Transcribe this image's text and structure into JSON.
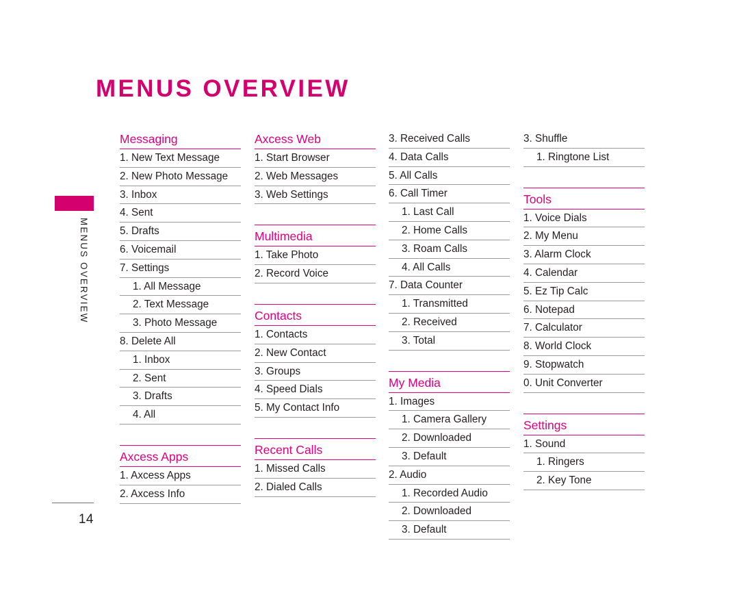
{
  "page": {
    "title": "MENUS OVERVIEW",
    "running_head": "MENUS OVERVIEW",
    "folio": "14",
    "accent_color": "#e0007d",
    "title_color": "#d4006e",
    "rule_color": "#9b9b9b",
    "text_color": "#231f20"
  },
  "columns": [
    {
      "name": "column-1",
      "sections": [
        {
          "heading": "Messaging",
          "has_top_rule": false,
          "items": [
            {
              "label": "1. New Text Message",
              "level": 1
            },
            {
              "label": "2. New Photo Message",
              "level": 1
            },
            {
              "label": "3. Inbox",
              "level": 1
            },
            {
              "label": "4. Sent",
              "level": 1
            },
            {
              "label": "5. Drafts",
              "level": 1
            },
            {
              "label": "6. Voicemail",
              "level": 1
            },
            {
              "label": "7. Settings",
              "level": 1
            },
            {
              "label": "1. All Message",
              "level": 2
            },
            {
              "label": "2. Text Message",
              "level": 2
            },
            {
              "label": "3. Photo Message",
              "level": 2
            },
            {
              "label": "8. Delete All",
              "level": 1
            },
            {
              "label": "1. Inbox",
              "level": 2
            },
            {
              "label": "2. Sent",
              "level": 2
            },
            {
              "label": "3. Drafts",
              "level": 2
            },
            {
              "label": "4. All",
              "level": 2
            }
          ]
        },
        {
          "heading": "Axcess Apps",
          "has_top_rule": true,
          "items": [
            {
              "label": "1. Axcess Apps",
              "level": 1
            },
            {
              "label": "2. Axcess Info",
              "level": 1
            }
          ]
        }
      ]
    },
    {
      "name": "column-2",
      "sections": [
        {
          "heading": "Axcess Web",
          "has_top_rule": false,
          "items": [
            {
              "label": "1. Start Browser",
              "level": 1
            },
            {
              "label": "2. Web Messages",
              "level": 1
            },
            {
              "label": "3. Web Settings",
              "level": 1
            }
          ]
        },
        {
          "heading": "Multimedia",
          "has_top_rule": true,
          "items": [
            {
              "label": "1. Take Photo",
              "level": 1
            },
            {
              "label": "2. Record Voice",
              "level": 1
            }
          ]
        },
        {
          "heading": "Contacts",
          "has_top_rule": true,
          "items": [
            {
              "label": "1. Contacts",
              "level": 1
            },
            {
              "label": "2. New Contact",
              "level": 1
            },
            {
              "label": "3. Groups",
              "level": 1
            },
            {
              "label": "4. Speed Dials",
              "level": 1
            },
            {
              "label": "5. My Contact Info",
              "level": 1
            }
          ]
        },
        {
          "heading": "Recent Calls",
          "has_top_rule": true,
          "items": [
            {
              "label": "1. Missed Calls",
              "level": 1
            },
            {
              "label": "2. Dialed Calls",
              "level": 1
            }
          ]
        }
      ]
    },
    {
      "name": "column-3",
      "sections": [
        {
          "heading": null,
          "continued": true,
          "has_top_rule": false,
          "items": [
            {
              "label": "3. Received Calls",
              "level": 1
            },
            {
              "label": "4. Data Calls",
              "level": 1
            },
            {
              "label": "5. All Calls",
              "level": 1
            },
            {
              "label": "6. Call Timer",
              "level": 1
            },
            {
              "label": "1. Last Call",
              "level": 2
            },
            {
              "label": "2. Home Calls",
              "level": 2
            },
            {
              "label": "3. Roam Calls",
              "level": 2
            },
            {
              "label": "4. All Calls",
              "level": 2
            },
            {
              "label": "7. Data Counter",
              "level": 1
            },
            {
              "label": "1. Transmitted",
              "level": 2
            },
            {
              "label": "2. Received",
              "level": 2
            },
            {
              "label": "3. Total",
              "level": 2
            }
          ]
        },
        {
          "heading": "My Media",
          "has_top_rule": true,
          "items": [
            {
              "label": "1. Images",
              "level": 1
            },
            {
              "label": "1. Camera Gallery",
              "level": 2
            },
            {
              "label": "2. Downloaded",
              "level": 2
            },
            {
              "label": "3. Default",
              "level": 2
            },
            {
              "label": "2. Audio",
              "level": 1
            },
            {
              "label": "1. Recorded Audio",
              "level": 2
            },
            {
              "label": "2. Downloaded",
              "level": 2
            },
            {
              "label": "3. Default",
              "level": 2
            }
          ]
        }
      ]
    },
    {
      "name": "column-4",
      "sections": [
        {
          "heading": null,
          "continued": true,
          "has_top_rule": false,
          "items": [
            {
              "label": "3. Shuffle",
              "level": 1
            },
            {
              "label": "1. Ringtone List",
              "level": 2
            }
          ]
        },
        {
          "heading": "Tools",
          "has_top_rule": true,
          "items": [
            {
              "label": "1. Voice Dials",
              "level": 1
            },
            {
              "label": "2. My Menu",
              "level": 1
            },
            {
              "label": "3. Alarm Clock",
              "level": 1
            },
            {
              "label": "4. Calendar",
              "level": 1
            },
            {
              "label": "5. Ez Tip Calc",
              "level": 1
            },
            {
              "label": "6. Notepad",
              "level": 1
            },
            {
              "label": "7. Calculator",
              "level": 1
            },
            {
              "label": "8. World Clock",
              "level": 1
            },
            {
              "label": "9. Stopwatch",
              "level": 1
            },
            {
              "label": "0. Unit Converter",
              "level": 1
            }
          ]
        },
        {
          "heading": "Settings",
          "has_top_rule": true,
          "items": [
            {
              "label": "1. Sound",
              "level": 1
            },
            {
              "label": "1. Ringers",
              "level": 2
            },
            {
              "label": "2. Key Tone",
              "level": 2
            }
          ]
        }
      ]
    }
  ]
}
